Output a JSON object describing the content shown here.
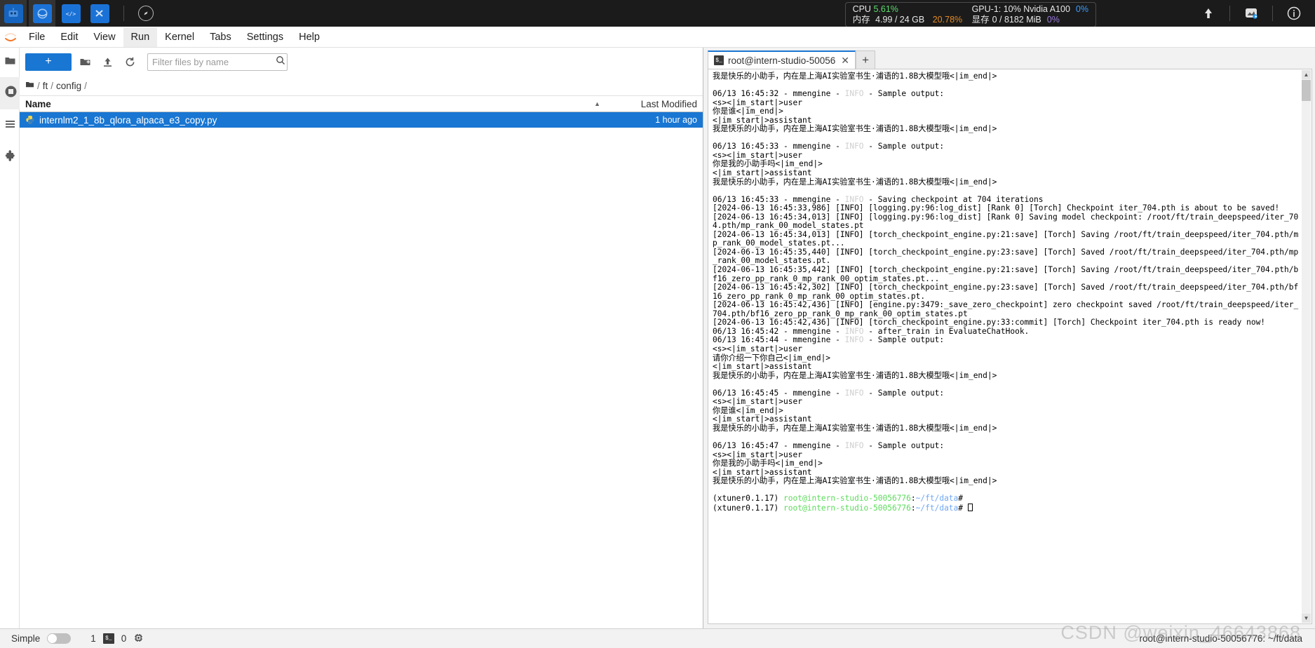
{
  "taskbar": {
    "apps": [
      {
        "name": "app-icon-robot",
        "glyph": "⚙"
      },
      {
        "name": "app-icon-circle",
        "glyph": "◯"
      },
      {
        "name": "app-icon-code",
        "glyph": "</>"
      },
      {
        "name": "app-icon-vscode",
        "glyph": "✖"
      }
    ],
    "compass_icon": "compass-icon",
    "sysmon": {
      "cpu_label": "CPU",
      "cpu_value": "5.61%",
      "mem_label": "内存",
      "mem_value": "4.99 / 24 GB",
      "mem_percent": "20.78%",
      "gpu_label": "GPU-1: 10% Nvidia A100",
      "gpu_percent": "0%",
      "vram_label": "显存",
      "vram_value": "0 / 8182 MiB",
      "vram_percent": "0%"
    },
    "tray": [
      {
        "name": "upload-arrow-icon",
        "glyph": "↑"
      },
      {
        "name": "screenshot-icon",
        "glyph": "◰"
      },
      {
        "name": "info-icon",
        "glyph": "ⓘ"
      }
    ]
  },
  "menubar": {
    "logo": "jupyter-logo",
    "items": [
      {
        "label": "File",
        "selected": false
      },
      {
        "label": "Edit",
        "selected": false
      },
      {
        "label": "View",
        "selected": false
      },
      {
        "label": "Run",
        "selected": true
      },
      {
        "label": "Kernel",
        "selected": false
      },
      {
        "label": "Tabs",
        "selected": false
      },
      {
        "label": "Settings",
        "selected": false
      },
      {
        "label": "Help",
        "selected": false
      }
    ]
  },
  "activitybar": {
    "items": [
      {
        "name": "sidebar-item-file-browser",
        "icon": "folder-icon",
        "active": false
      },
      {
        "name": "sidebar-item-running",
        "icon": "stop-circle-icon",
        "active": true
      },
      {
        "name": "sidebar-item-commands",
        "icon": "list-icon",
        "active": false
      },
      {
        "name": "sidebar-item-extensions",
        "icon": "puzzle-icon",
        "active": false
      }
    ]
  },
  "filebrowser": {
    "new_button_label": "+",
    "tools": [
      {
        "name": "new-folder-button",
        "icon": "new-folder-icon"
      },
      {
        "name": "upload-button",
        "icon": "upload-icon"
      },
      {
        "name": "refresh-button",
        "icon": "refresh-icon"
      }
    ],
    "filter": {
      "placeholder": "Filter files by name",
      "value": "",
      "icon": "search-icon"
    },
    "breadcrumb": {
      "home_icon": "folder-icon",
      "parts": [
        "ft",
        "config"
      ]
    },
    "columns": {
      "name": "Name",
      "last_modified": "Last Modified"
    },
    "rows": [
      {
        "icon": "python-file-icon",
        "name": "internlm2_1_8b_qlora_alpaca_e3_copy.py",
        "modified": "1 hour ago",
        "selected": true
      }
    ]
  },
  "terminal": {
    "tab": {
      "icon": "terminal-icon",
      "title": "root@intern-studio-50056",
      "close_icon": "close-icon"
    },
    "add_tab_label": "+",
    "scrollbar": {
      "up_icon": "chevron-up-icon",
      "down_icon": "chevron-down-icon"
    },
    "lines": [
      "我是快乐的小助手，内在是上海AI实验室书生·浦语的1.8B大模型哦<|im_end|>",
      "",
      "06/13 16:45:32 - mmengine - ▒INFO▒ - Sample output:",
      "<s><|im_start|>user",
      "你是谁<|im_end|>",
      "<|im_start|>assistant",
      "我是快乐的小助手，内在是上海AI实验室书生·浦语的1.8B大模型哦<|im_end|>",
      "",
      "06/13 16:45:33 - mmengine - ▒INFO▒ - Sample output:",
      "<s><|im_start|>user",
      "你是我的小助手吗<|im_end|>",
      "<|im_start|>assistant",
      "我是快乐的小助手，内在是上海AI实验室书生·浦语的1.8B大模型哦<|im_end|>",
      "",
      "06/13 16:45:33 - mmengine - ▒INFO▒ - Saving checkpoint at 704 iterations",
      "[2024-06-13 16:45:33,986] [INFO] [logging.py:96:log_dist] [Rank 0] [Torch] Checkpoint iter_704.pth is about to be saved!",
      "[2024-06-13 16:45:34,013] [INFO] [logging.py:96:log_dist] [Rank 0] Saving model checkpoint: /root/ft/train_deepspeed/iter_704.pth/mp_rank_00_model_states.pt",
      "[2024-06-13 16:45:34,013] [INFO] [torch_checkpoint_engine.py:21:save] [Torch] Saving /root/ft/train_deepspeed/iter_704.pth/mp_rank_00_model_states.pt...",
      "[2024-06-13 16:45:35,440] [INFO] [torch_checkpoint_engine.py:23:save] [Torch] Saved /root/ft/train_deepspeed/iter_704.pth/mp_rank_00_model_states.pt.",
      "[2024-06-13 16:45:35,442] [INFO] [torch_checkpoint_engine.py:21:save] [Torch] Saving /root/ft/train_deepspeed/iter_704.pth/bf16_zero_pp_rank_0_mp_rank_00_optim_states.pt...",
      "[2024-06-13 16:45:42,302] [INFO] [torch_checkpoint_engine.py:23:save] [Torch] Saved /root/ft/train_deepspeed/iter_704.pth/bf16_zero_pp_rank_0_mp_rank_00_optim_states.pt.",
      "[2024-06-13 16:45:42,436] [INFO] [engine.py:3479:_save_zero_checkpoint] zero checkpoint saved /root/ft/train_deepspeed/iter_704.pth/bf16_zero_pp_rank_0_mp_rank_00_optim_states.pt",
      "[2024-06-13 16:45:42,436] [INFO] [torch_checkpoint_engine.py:33:commit] [Torch] Checkpoint iter_704.pth is ready now!",
      "06/13 16:45:42 - mmengine - ▒INFO▒ - after_train in EvaluateChatHook.",
      "06/13 16:45:44 - mmengine - ▒INFO▒ - Sample output:",
      "<s><|im_start|>user",
      "请你介绍一下你自己<|im_end|>",
      "<|im_start|>assistant",
      "我是快乐的小助手，内在是上海AI实验室书生·浦语的1.8B大模型哦<|im_end|>",
      "",
      "06/13 16:45:45 - mmengine - ▒INFO▒ - Sample output:",
      "<s><|im_start|>user",
      "你是谁<|im_end|>",
      "<|im_start|>assistant",
      "我是快乐的小助手，内在是上海AI实验室书生·浦语的1.8B大模型哦<|im_end|>",
      "",
      "06/13 16:45:47 - mmengine - ▒INFO▒ - Sample output:",
      "<s><|im_start|>user",
      "你是我的小助手吗<|im_end|>",
      "<|im_start|>assistant",
      "我是快乐的小助手，内在是上海AI实验室书生·浦语的1.8B大模型哦<|im_end|>",
      ""
    ],
    "prompt": {
      "env": "(xtuner0.1.17)",
      "user_host": "root@intern-studio-50056776",
      "colon": ":",
      "path": "~/ft/data",
      "symbol": "#"
    },
    "prompt_repeat": 2
  },
  "statusbar": {
    "mode_label": "Simple",
    "toggle_on": false,
    "kernel_count": "1",
    "terminal_icon": "terminal-icon",
    "terminal_count": "0",
    "resource_icon": "cpu-chip-icon",
    "right_text": "root@intern-studio-50056776: ~/ft/data"
  },
  "watermark": "CSDN @weixin_46643868",
  "colors": {
    "accent": "#1976d2",
    "taskbar_bg": "#1b1b1b",
    "panel_bg": "#f2f2f2",
    "cpu_green": "#5cdb6d",
    "mem_orange": "#e08a27",
    "gpu_blue": "#3d9dff",
    "vram_purple": "#9b7bdb"
  }
}
